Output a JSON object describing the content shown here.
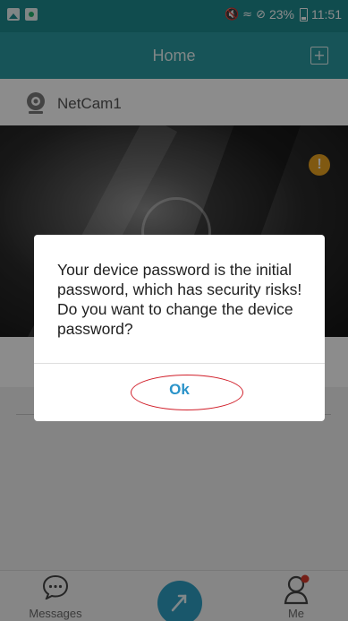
{
  "status_bar": {
    "battery": "23%",
    "time": "11:51",
    "icons": [
      "gallery-icon",
      "app-icon",
      "mute-icon",
      "wifi-icon",
      "no-disturb-icon",
      "battery-icon"
    ]
  },
  "header": {
    "title": "Home",
    "add_icon": "plus-square-icon"
  },
  "device": {
    "name": "NetCam1",
    "icon": "webcam-icon",
    "warning_icon_label": "!"
  },
  "dialog": {
    "message": "Your device password is the initial password, which has security risks! Do you want to change the device password?",
    "ok_label": "Ok"
  },
  "bottom_nav": {
    "messages_label": "Messages",
    "me_label": "Me"
  },
  "colors": {
    "status_bar": "#1e8a8f",
    "header": "#2b9aa0",
    "ok_text": "#2a93c9",
    "annotation_ring": "#d11f2a",
    "warning": "#e9a21f",
    "fab": "#2e9fc4"
  }
}
